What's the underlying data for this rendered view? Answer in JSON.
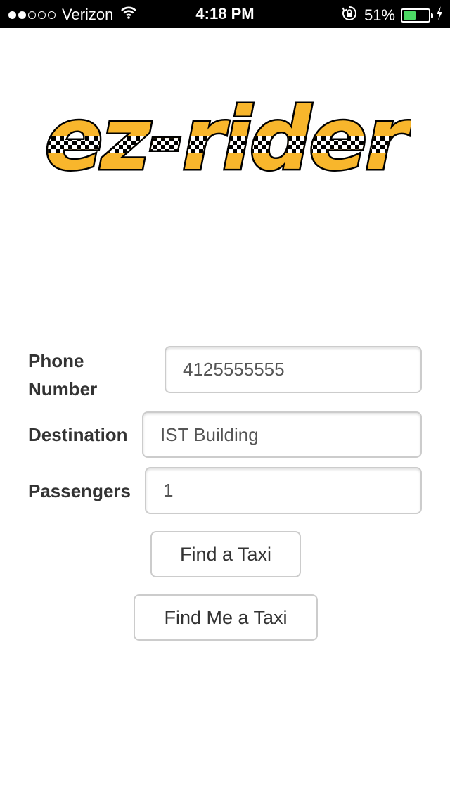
{
  "status_bar": {
    "signal_filled": 2,
    "signal_total": 5,
    "carrier": "Verizon",
    "time": "4:18 PM",
    "battery_percent_text": "51%",
    "battery_level": 0.51,
    "battery_color": "#4cd964",
    "icons": [
      "wifi-icon",
      "rotation-lock-icon",
      "battery-icon",
      "charging-bolt-icon"
    ]
  },
  "logo": {
    "text": "ez-rider",
    "fill_color": "#f8b62c",
    "outline_color": "#000000"
  },
  "form": {
    "phone_label": "Phone Number",
    "phone_value": "4125555555",
    "destination_label": "Destination",
    "destination_value": "IST Building",
    "passengers_label": "Passengers",
    "passengers_value": "1"
  },
  "buttons": {
    "find_taxi": "Find a Taxi",
    "find_me_taxi": "Find Me a Taxi"
  }
}
